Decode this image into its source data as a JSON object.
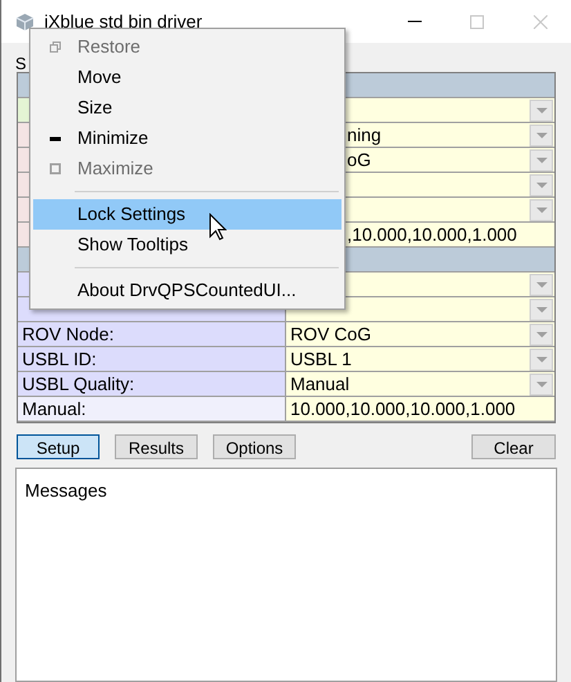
{
  "window": {
    "title": "iXblue std bin driver"
  },
  "section_label": "S",
  "sections": [
    {
      "rows": [
        {
          "kind": "dropdown",
          "color": "#e4f4d4"
        },
        {
          "kind": "dropdown",
          "color": "#f4e4e4",
          "value": "ning",
          "clipped": true
        },
        {
          "kind": "dropdown",
          "color": "#f4e4e4",
          "value": "oG",
          "clipped": true
        },
        {
          "kind": "dropdown",
          "color": "#f4e4e4"
        },
        {
          "kind": "dropdown",
          "color": "#f4e4e4"
        },
        {
          "kind": "text",
          "color": "#f4e4e4",
          "value": ",10.000,10.000,1.000",
          "clipped": true
        }
      ]
    },
    {
      "rows": [
        {
          "kind": "dropdown",
          "color": "#dcdcfc"
        },
        {
          "kind": "dropdown",
          "color": "#dcdcfc"
        },
        {
          "kind": "dropdown",
          "color": "#dcdcfc",
          "label": "ROV Node:",
          "value": "ROV CoG"
        },
        {
          "kind": "dropdown",
          "color": "#dcdcfc",
          "label": "USBL ID:",
          "value": "USBL 1"
        },
        {
          "kind": "dropdown",
          "color": "#dcdcfc",
          "label": "USBL Quality:",
          "value": "Manual"
        },
        {
          "kind": "text",
          "color": "#f0f0fc",
          "label": "Manual:",
          "value": "10.000,10.000,10.000,1.000"
        }
      ]
    }
  ],
  "tabs": [
    {
      "label": "Setup",
      "selected": true
    },
    {
      "label": "Results",
      "selected": false
    },
    {
      "label": "Options",
      "selected": false
    }
  ],
  "clear_button": "Clear",
  "messages": {
    "placeholder": "Messages"
  },
  "system_menu": [
    {
      "kind": "restore",
      "label": "Restore",
      "disabled": true,
      "selected": false
    },
    {
      "kind": "plain",
      "label": "Move",
      "disabled": false,
      "selected": false
    },
    {
      "kind": "plain",
      "label": "Size",
      "disabled": false,
      "selected": false
    },
    {
      "kind": "minimize",
      "label": "Minimize",
      "disabled": false,
      "selected": false
    },
    {
      "kind": "maximize",
      "label": "Maximize",
      "disabled": true,
      "selected": false
    },
    {
      "kind": "separator"
    },
    {
      "kind": "plain",
      "label": "Lock Settings",
      "disabled": false,
      "selected": true
    },
    {
      "kind": "plain",
      "label": "Show Tooltips",
      "disabled": false,
      "selected": false
    },
    {
      "kind": "separator"
    },
    {
      "kind": "plain",
      "label": "About DrvQPSCountedUI...",
      "disabled": false,
      "selected": false
    }
  ]
}
